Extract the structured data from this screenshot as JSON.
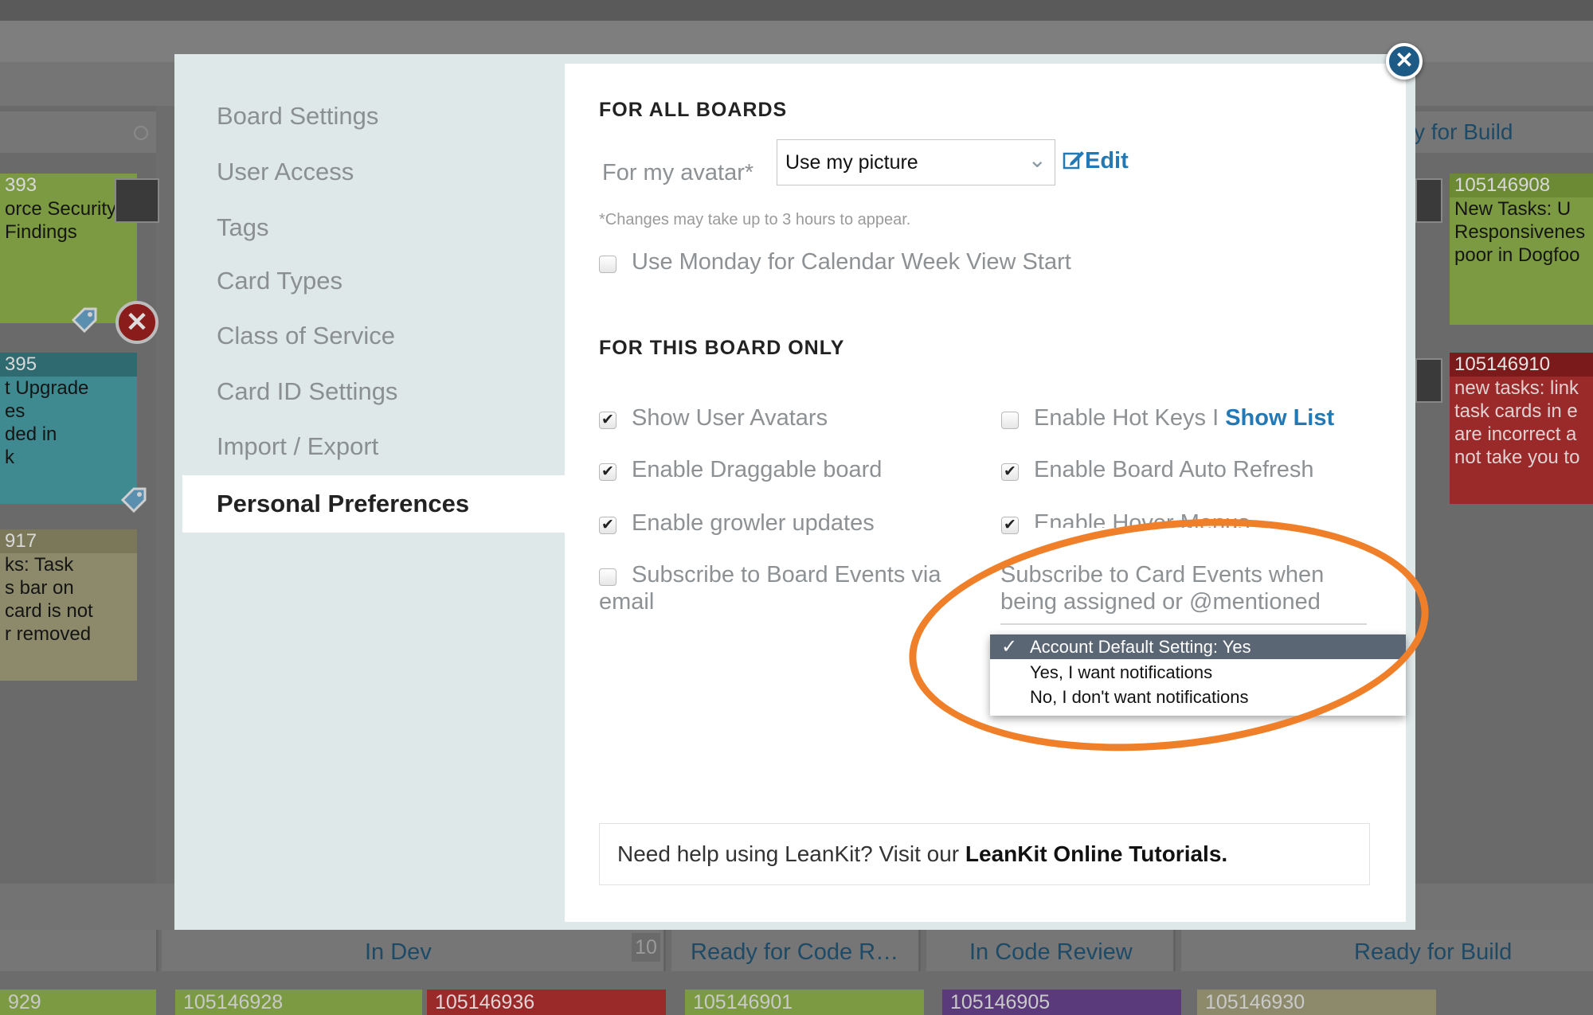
{
  "background": {
    "left_cards": [
      {
        "id": "393",
        "text": "orce Security\nFindings",
        "color": "#7c9a42"
      },
      {
        "id": "395",
        "text": "t Upgrade\nes\nded in\nk",
        "color": "#3f8a90"
      },
      {
        "id": "917",
        "text": "ks: Task\ns bar on\ncard is not\nr removed",
        "color": "#8c8a6a"
      }
    ],
    "right_lane_title": "y for Build",
    "right_cards": [
      {
        "id": "105146908",
        "text": "New Tasks: U\nResponsivenes\npoor in Dogfoo",
        "color": "#7c9a42"
      },
      {
        "id": "105146910",
        "text": "new tasks: link\ntask cards in e\nare incorrect a\nnot take you to",
        "color": "#9a2a2a"
      }
    ],
    "bottom_lanes": [
      {
        "title": "In Dev",
        "wip": "10"
      },
      {
        "title": "Ready for Code R…"
      },
      {
        "title": "In Code Review"
      },
      {
        "title": "Ready for Build"
      }
    ],
    "bottom_cards": [
      {
        "id": "929"
      },
      {
        "id": "105146928"
      },
      {
        "id": "105146936"
      },
      {
        "id": "105146901"
      },
      {
        "id": "105146905"
      },
      {
        "id": "105146930"
      }
    ]
  },
  "nav": {
    "items": [
      {
        "label": "Board Settings"
      },
      {
        "label": "User Access"
      },
      {
        "label": "Tags"
      },
      {
        "label": "Card Types"
      },
      {
        "label": "Class of Service"
      },
      {
        "label": "Card ID Settings"
      },
      {
        "label": "Import / Export"
      },
      {
        "label": "Personal Preferences",
        "active": true
      }
    ]
  },
  "all_boards": {
    "title": "FOR ALL BOARDS",
    "avatar_label": "For my avatar*",
    "avatar_value": "Use my picture",
    "edit_label": "Edit",
    "note": "*Changes may take up to 3 hours to appear.",
    "monday_label": "Use Monday for Calendar Week View Start",
    "monday_checked": false
  },
  "this_board": {
    "title": "FOR THIS BOARD ONLY",
    "show_avatars": {
      "label": "Show User Avatars",
      "checked": true
    },
    "draggable": {
      "label": "Enable Draggable board",
      "checked": true
    },
    "growler": {
      "label": "Enable growler updates",
      "checked": true
    },
    "subscribe_board": {
      "label": "Subscribe to Board Events via",
      "label2": "email",
      "checked": false
    },
    "hot_keys": {
      "label": "Enable Hot Keys I",
      "link": "Show List",
      "checked": false
    },
    "auto_refresh": {
      "label": "Enable Board Auto Refresh",
      "checked": true
    },
    "hover_menus": {
      "label": "Enable Hover Menus",
      "checked": true
    },
    "card_events": {
      "line1": "Subscribe to Card Events when",
      "line2": "being assigned or @mentioned"
    }
  },
  "dropdown": {
    "options": [
      {
        "label": "Account Default Setting: Yes",
        "selected": true
      },
      {
        "label": "Yes, I want notifications",
        "selected": false
      },
      {
        "label": "No, I don't want notifications",
        "selected": false
      }
    ],
    "check_glyph": "✓"
  },
  "help": {
    "text": "Need help using LeanKit? Visit our ",
    "link": "LeanKit Online Tutorials."
  },
  "colors": {
    "accent_link": "#2379b5",
    "highlight_ring": "#f07f2a",
    "close_button": "#1e5a86"
  }
}
